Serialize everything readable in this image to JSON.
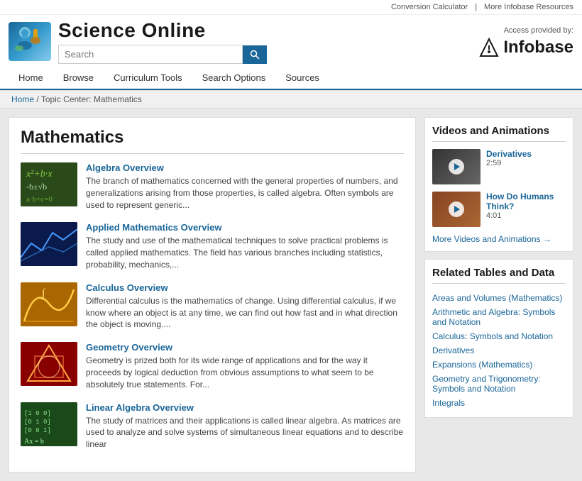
{
  "utility": {
    "conversion_calculator": "Conversion Calculator",
    "more_infobase": "More Infobase Resources",
    "access_provided": "Access provided by:"
  },
  "header": {
    "title": "Science Online",
    "search_placeholder": "Search",
    "infobase_logo_text": "Infobase"
  },
  "nav": {
    "items": [
      {
        "label": "Home",
        "active": false
      },
      {
        "label": "Browse",
        "active": false
      },
      {
        "label": "Curriculum Tools",
        "active": false
      },
      {
        "label": "Search Options",
        "active": false
      },
      {
        "label": "Sources",
        "active": false
      }
    ]
  },
  "breadcrumb": {
    "home": "Home",
    "separator": " / ",
    "current": "Topic Center: Mathematics"
  },
  "main": {
    "page_title": "Mathematics",
    "articles": [
      {
        "title": "Algebra Overview",
        "description": "The branch of mathematics concerned with the general properties of numbers, and generalizations arising from those properties, is called algebra. Often symbols are used to represent generic...",
        "thumb_class": "thumb-algebra"
      },
      {
        "title": "Applied Mathematics Overview",
        "description": "The study and use of the mathematical techniques to solve practical problems is called applied mathematics. The field has various branches including statistics, probability, mechanics,...",
        "thumb_class": "thumb-applied"
      },
      {
        "title": "Calculus Overview",
        "description": "Differential calculus is the mathematics of change. Using differential calculus, if we know where an object is at any time, we can find out how fast and in what direction the object is moving....",
        "thumb_class": "thumb-calculus"
      },
      {
        "title": "Geometry Overview",
        "description": "Geometry is prized both for its wide range of applications and for the way it proceeds by logical deduction from obvious assumptions to what seem to be absolutely true statements. For...",
        "thumb_class": "thumb-geometry"
      },
      {
        "title": "Linear Algebra Overview",
        "description": "The study of matrices and their applications is called linear algebra. As matrices are used to analyze and solve systems of simultaneous linear equations and to describe linear",
        "thumb_class": "thumb-linear"
      }
    ]
  },
  "sidebar": {
    "videos_title": "Videos and Animations",
    "videos": [
      {
        "title": "Derivatives",
        "duration": "2:59",
        "thumb_class": "video-thumb-derivatives"
      },
      {
        "title": "How Do Humans Think?",
        "duration": "4:01",
        "thumb_class": "video-thumb-humans"
      }
    ],
    "more_videos": "More Videos and Animations →",
    "related_title": "Related Tables and Data",
    "related_links": [
      "Areas and Volumes (Mathematics)",
      "Arithmetic and Algebra: Symbols and Notation",
      "Calculus: Symbols and Notation",
      "Derivatives",
      "Expansions (Mathematics)",
      "Geometry and Trigonometry: Symbols and Notation",
      "Integrals"
    ]
  }
}
